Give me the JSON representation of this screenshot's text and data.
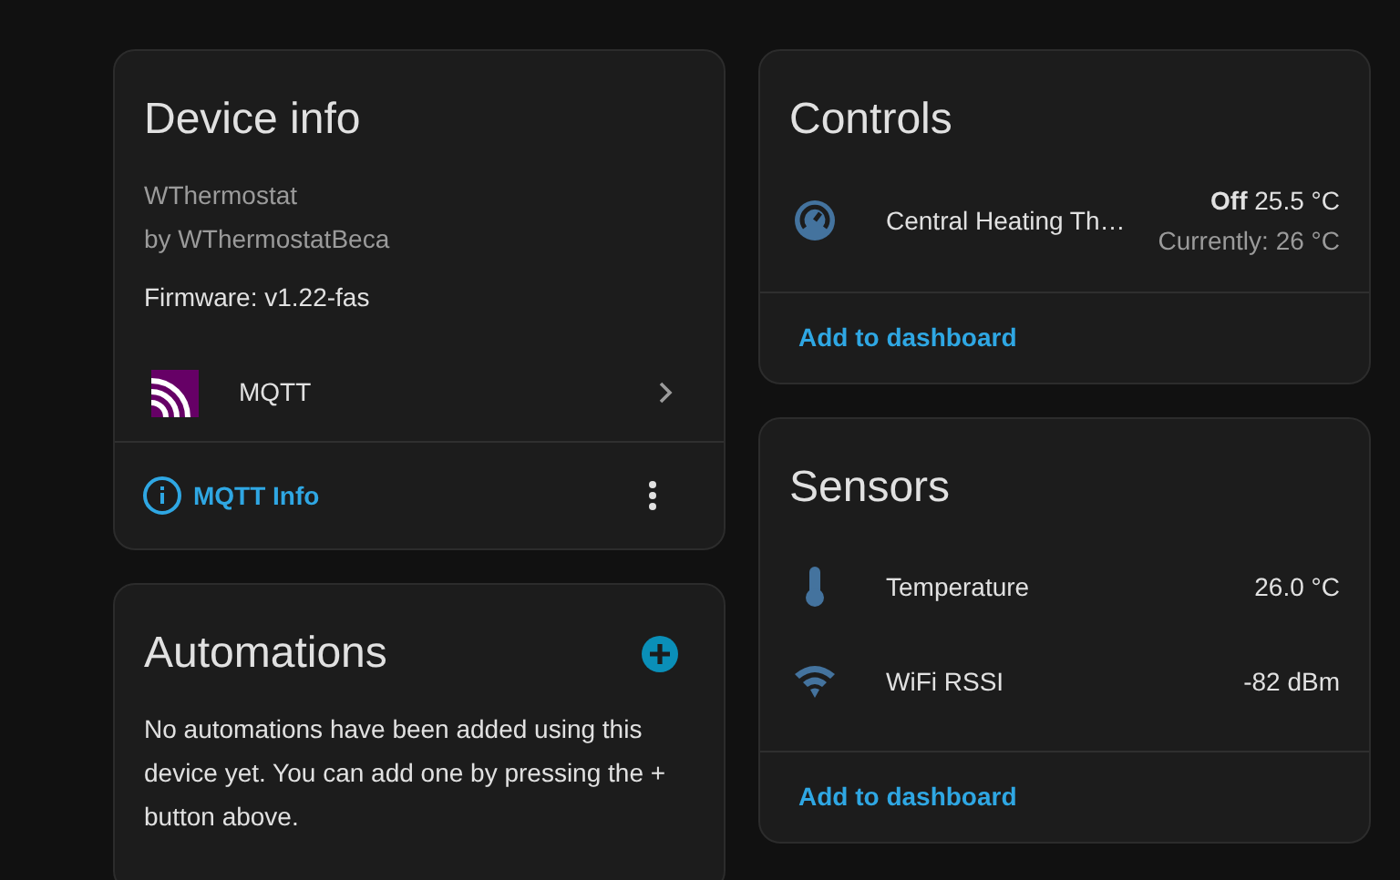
{
  "device_info": {
    "title": "Device info",
    "model": "WThermostat",
    "manufacturer": "by WThermostatBeca",
    "firmware": "Firmware: v1.22-fas",
    "integration": {
      "name": "MQTT"
    },
    "action": {
      "label": "MQTT Info"
    }
  },
  "automations": {
    "title": "Automations",
    "text": "No automations have been added using this device yet. You can add one by pressing the + button above."
  },
  "controls": {
    "title": "Controls",
    "entities": [
      {
        "kind": "thermostat",
        "name": "Central Heating Th…",
        "state": "Off",
        "target": "25.5 °C",
        "current": "Currently: 26 °C"
      }
    ],
    "action": "Add to dashboard"
  },
  "sensors": {
    "title": "Sensors",
    "entities": [
      {
        "kind": "temperature",
        "name": "Temperature",
        "value": "26.0 °C"
      },
      {
        "kind": "wifi",
        "name": "WiFi RSSI",
        "value": "-82 dBm"
      }
    ],
    "action": "Add to dashboard"
  }
}
